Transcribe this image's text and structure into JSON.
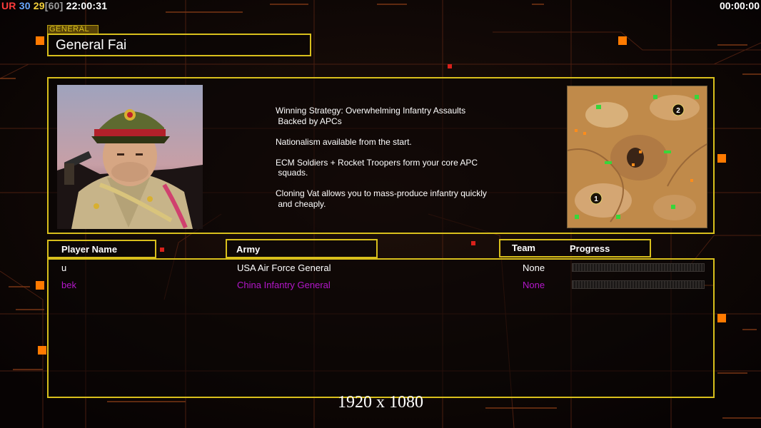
{
  "hud": {
    "ur_label": "UR",
    "ur_value": "30",
    "fps": "29",
    "fps_cap": "[60]",
    "clock": "22:00:31",
    "timer": "00:00:00"
  },
  "general": {
    "tag": "GENERAL",
    "name": "General Fai"
  },
  "strategy": {
    "lines": [
      "Winning Strategy: Overwhelming Infantry Assaults\n Backed by APCs",
      "Nationalism available from the start.",
      "ECM Soldiers + Rocket Troopers form your core APC\n squads.",
      "Cloning Vat allows you to mass-produce infantry quickly\n and cheaply."
    ]
  },
  "minimap": {
    "start_positions": [
      "1",
      "2"
    ]
  },
  "table": {
    "headers": {
      "player": "Player Name",
      "army": "Army",
      "team": "Team",
      "progress": "Progress"
    },
    "rows": [
      {
        "player": "u",
        "army": "USA Air Force General",
        "team": "None",
        "color": "#ffffff",
        "progress": 0
      },
      {
        "player": "bek",
        "army": "China Infantry General",
        "team": "None",
        "color": "#b317c9",
        "progress": 0
      }
    ]
  },
  "footer": {
    "resolution": "1920 x 1080"
  },
  "colors": {
    "frame": "#d8bf1c",
    "accent_orange": "#ff7a00",
    "player2": "#b317c9"
  }
}
